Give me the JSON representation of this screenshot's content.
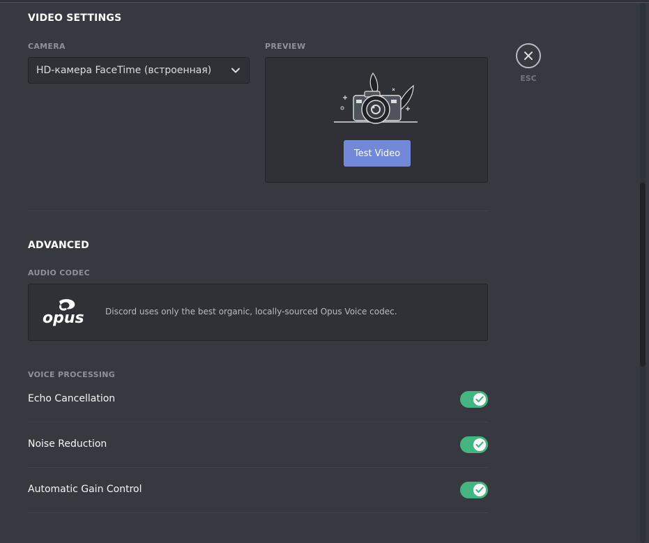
{
  "video_settings": {
    "title": "VIDEO SETTINGS",
    "camera_label": "CAMERA",
    "camera_value": "HD-камера FaceTime (встроенная)",
    "preview_label": "PREVIEW",
    "test_video_label": "Test Video"
  },
  "advanced": {
    "title": "ADVANCED",
    "audio_codec_label": "AUDIO CODEC",
    "codec_description": "Discord uses only the best organic, locally-sourced Opus Voice codec.",
    "codec_logo_text": "opus",
    "voice_processing_label": "VOICE PROCESSING",
    "options": [
      {
        "label": "Echo Cancellation",
        "enabled": true
      },
      {
        "label": "Noise Reduction",
        "enabled": true
      },
      {
        "label": "Automatic Gain Control",
        "enabled": true
      }
    ]
  },
  "close": {
    "esc_label": "ESC",
    "icon": "close-icon"
  },
  "colors": {
    "background": "#36393f",
    "accent": "#7289da",
    "toggle_on": "#43b581"
  }
}
